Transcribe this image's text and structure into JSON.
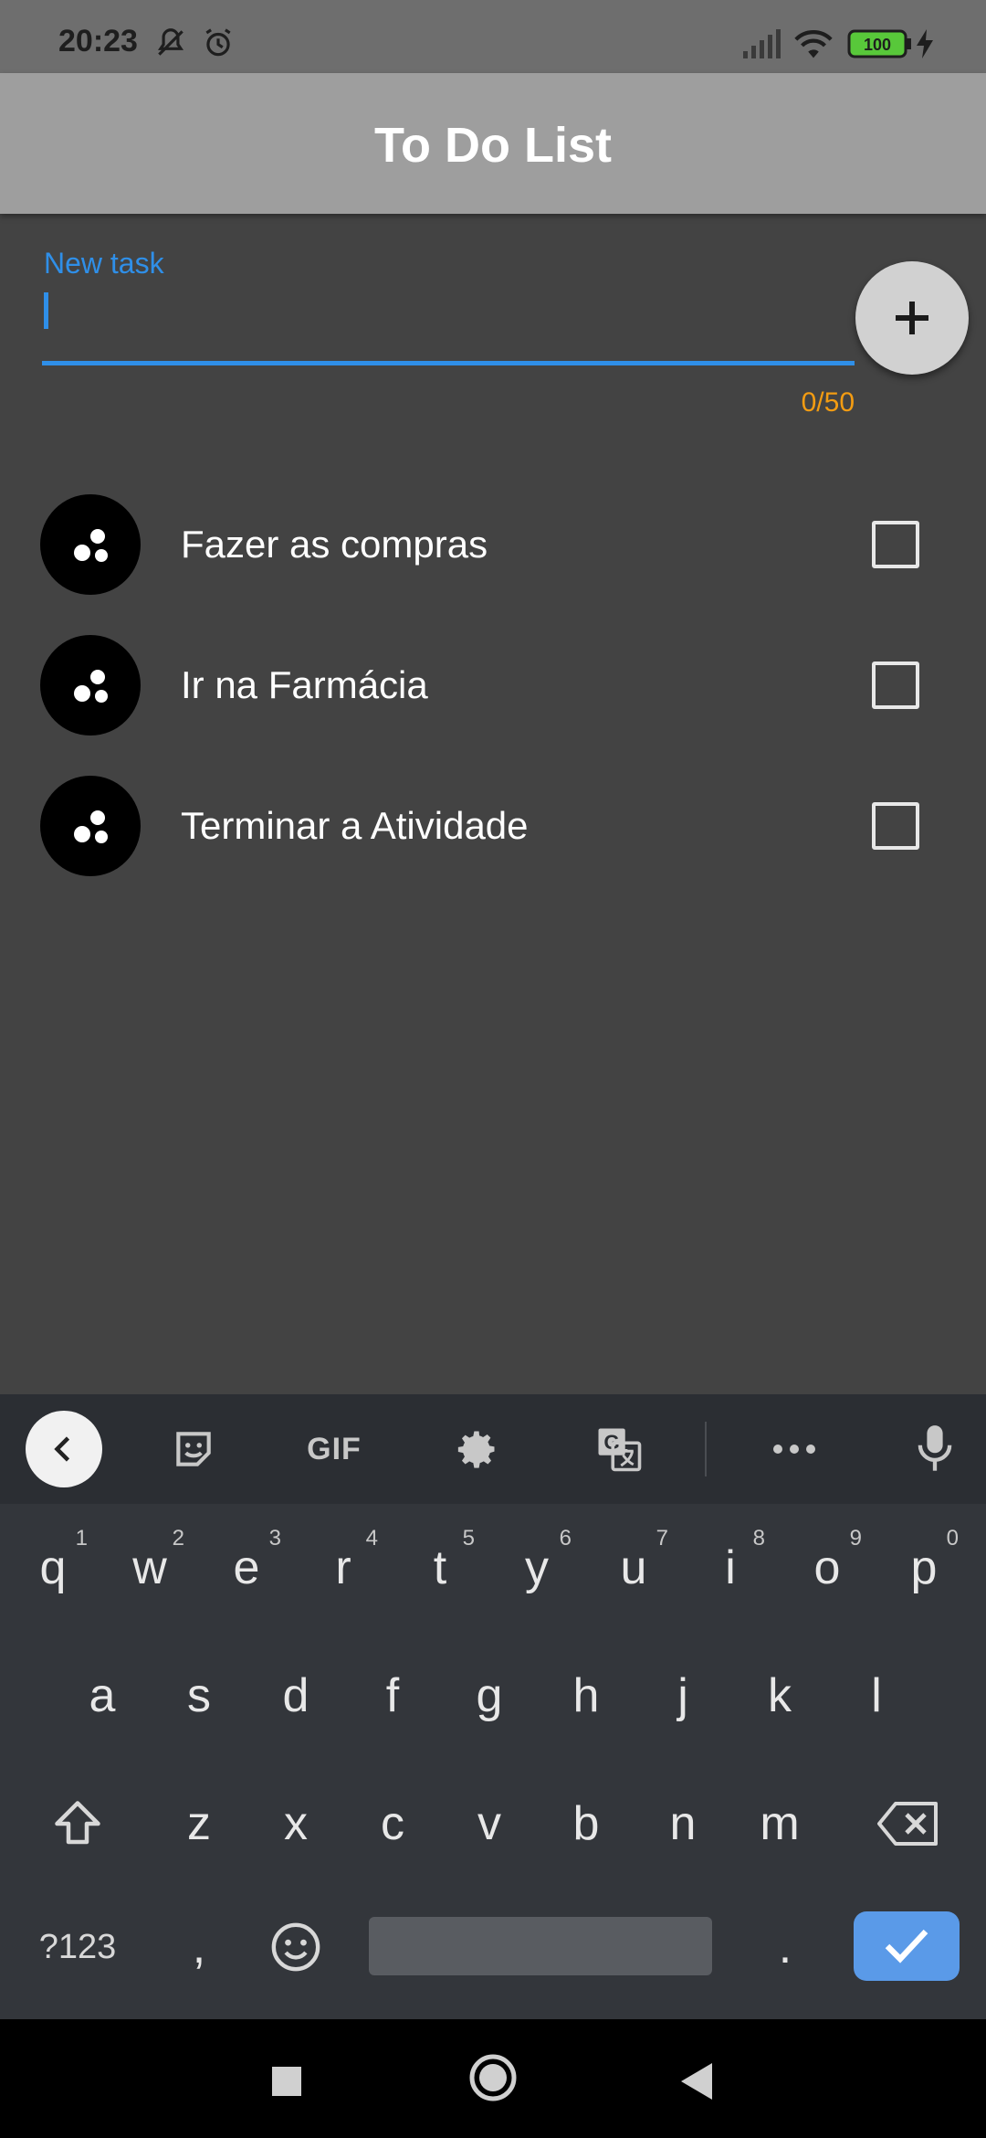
{
  "status_bar": {
    "time": "20:23",
    "battery": "100"
  },
  "app_bar": {
    "title": "To Do List"
  },
  "new_task": {
    "label": "New task",
    "value": "",
    "counter": "0/50"
  },
  "tasks": [
    {
      "label": "Fazer as compras",
      "checked": false
    },
    {
      "label": "Ir na Farmácia",
      "checked": false
    },
    {
      "label": "Terminar a Atividade",
      "checked": false
    }
  ],
  "keyboard": {
    "toolbar": [
      "back-icon",
      "sticker-icon",
      "GIF",
      "gear-icon",
      "translate-icon",
      "more-icon",
      "mic-icon"
    ],
    "gif_label": "GIF",
    "row1": [
      "q",
      "w",
      "e",
      "r",
      "t",
      "y",
      "u",
      "i",
      "o",
      "p"
    ],
    "row1_hints": [
      "1",
      "2",
      "3",
      "4",
      "5",
      "6",
      "7",
      "8",
      "9",
      "0"
    ],
    "row2": [
      "a",
      "s",
      "d",
      "f",
      "g",
      "h",
      "j",
      "k",
      "l"
    ],
    "row3": [
      "z",
      "x",
      "c",
      "v",
      "b",
      "n",
      "m"
    ],
    "symbols_label": "?123",
    "comma": ",",
    "period": "."
  },
  "colors": {
    "accent": "#2f8fe8",
    "counter": "#f39c12",
    "app_bar": "#9e9e9e",
    "background": "#434343",
    "enter": "#5a9ae8"
  }
}
